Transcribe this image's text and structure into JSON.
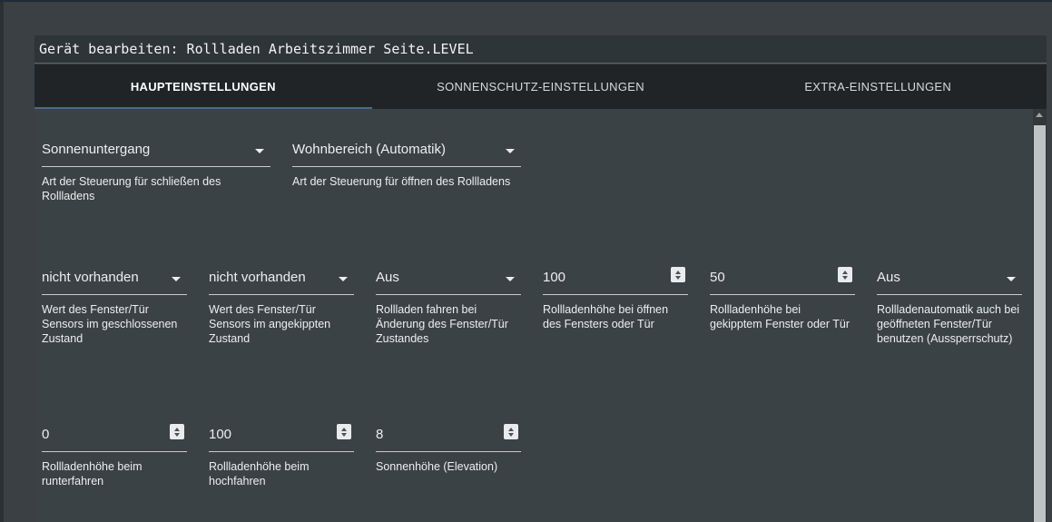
{
  "dialog": {
    "title": "Gerät bearbeiten: Rollladen Arbeitszimmer Seite.LEVEL"
  },
  "tabs": [
    {
      "label": "HAUPTEINSTELLUNGEN",
      "active": true
    },
    {
      "label": "SONNENSCHUTZ-EINSTELLUNGEN",
      "active": false
    },
    {
      "label": "EXTRA-EINSTELLUNGEN",
      "active": false
    }
  ],
  "fields": {
    "close_control": {
      "value": "Sonnenuntergang",
      "label": "Art der Steuerung für schließen des Rollladens"
    },
    "open_control": {
      "value": "Wohnbereich (Automatik)",
      "label": "Art der Steuerung für öffnen des Rollladens"
    },
    "sensor_closed": {
      "value": "nicht vorhanden",
      "label": "Wert des Fenster/Tür Sensors im geschlossenen Zustand"
    },
    "sensor_tilted": {
      "value": "nicht vorhanden",
      "label": "Wert des Fenster/Tür Sensors im angekippten Zustand"
    },
    "move_on_change": {
      "value": "Aus",
      "label": "Rollladen fahren bei Änderung des Fenster/Tür Zustandes"
    },
    "height_open_window": {
      "value": "100",
      "label": "Rollladenhöhe bei öffnen des Fensters oder Tür"
    },
    "height_tilted_window": {
      "value": "50",
      "label": "Rollladenhöhe bei gekipptem Fenster oder Tür"
    },
    "lockout_protection": {
      "value": "Aus",
      "label": "Rollladenautomatik auch bei geöffneten Fenster/Tür benutzen (Aussperrschutz)"
    },
    "height_down": {
      "value": "0",
      "label": "Rollladenhöhe beim runterfahren"
    },
    "height_up": {
      "value": "100",
      "label": "Rollladenhöhe beim hochfahren"
    },
    "sun_elevation": {
      "value": "8",
      "label": "Sonnenhöhe (Elevation)"
    }
  },
  "colors": {
    "background": "#3a4043",
    "tab_bar": "#212427",
    "accent": "#4a6a88"
  }
}
